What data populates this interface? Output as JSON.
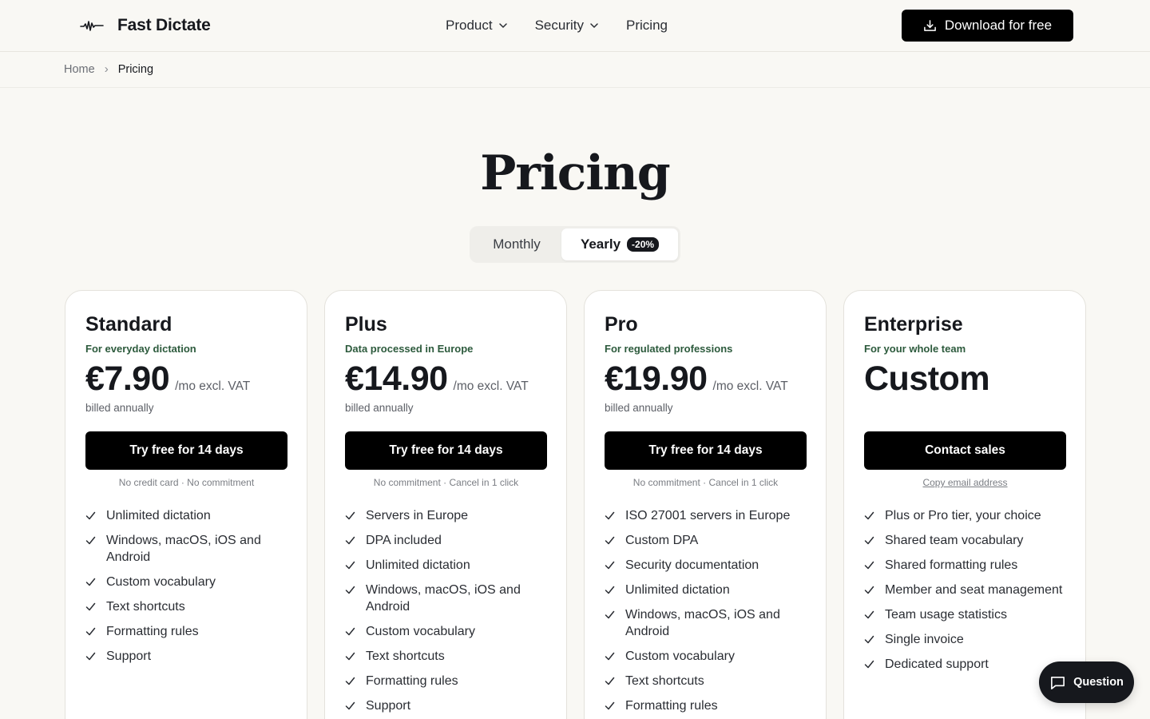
{
  "nav": {
    "brand": "Fast Dictate",
    "menu": [
      {
        "label": "Product",
        "has_dropdown": true
      },
      {
        "label": "Security",
        "has_dropdown": true
      },
      {
        "label": "Pricing",
        "has_dropdown": false
      }
    ],
    "download_label": "Download for free"
  },
  "breadcrumb": {
    "home": "Home",
    "separator": "›",
    "current": "Pricing"
  },
  "page": {
    "title": "Pricing"
  },
  "billing_toggle": {
    "monthly": "Monthly",
    "yearly": "Yearly",
    "yearly_badge": "-20%",
    "selected": "yearly"
  },
  "plans": [
    {
      "name": "Standard",
      "tagline": "For everyday dictation",
      "price": "€7.90",
      "unit": "/mo excl. VAT",
      "billed": "billed annually",
      "cta": "Try free for 14 days",
      "note": "No credit card · No commitment",
      "features": [
        "Unlimited dictation",
        "Windows, macOS, iOS and Android",
        "Custom vocabulary",
        "Text shortcuts",
        "Formatting rules",
        "Support"
      ]
    },
    {
      "name": "Plus",
      "tagline": "Data processed in Europe",
      "price": "€14.90",
      "unit": "/mo excl. VAT",
      "billed": "billed annually",
      "cta": "Try free for 14 days",
      "note": "No commitment · Cancel in 1 click",
      "features": [
        "Servers in Europe",
        "DPA included",
        "Unlimited dictation",
        "Windows, macOS, iOS and Android",
        "Custom vocabulary",
        "Text shortcuts",
        "Formatting rules",
        "Support"
      ]
    },
    {
      "name": "Pro",
      "tagline": "For regulated professions",
      "price": "€19.90",
      "unit": "/mo excl. VAT",
      "billed": "billed annually",
      "cta": "Try free for 14 days",
      "note": "No commitment · Cancel in 1 click",
      "features": [
        "ISO 27001 servers in Europe",
        "Custom DPA",
        "Security documentation",
        "Unlimited dictation",
        "Windows, macOS, iOS and Android",
        "Custom vocabulary",
        "Text shortcuts",
        "Formatting rules"
      ]
    },
    {
      "name": "Enterprise",
      "tagline": "For your whole team",
      "price": "Custom",
      "unit": "",
      "billed": "",
      "cta": "Contact sales",
      "note": "Copy email address",
      "features": [
        "Plus or Pro tier, your choice",
        "Shared team vocabulary",
        "Shared formatting rules",
        "Member and seat management",
        "Team usage statistics",
        "Single invoice",
        "Dedicated support"
      ]
    }
  ],
  "question_button": {
    "label": "Question"
  },
  "colors": {
    "background": "#f9f8f4",
    "primary": "#000000",
    "tagline": "#2c5a3c",
    "text": "#16181d"
  }
}
